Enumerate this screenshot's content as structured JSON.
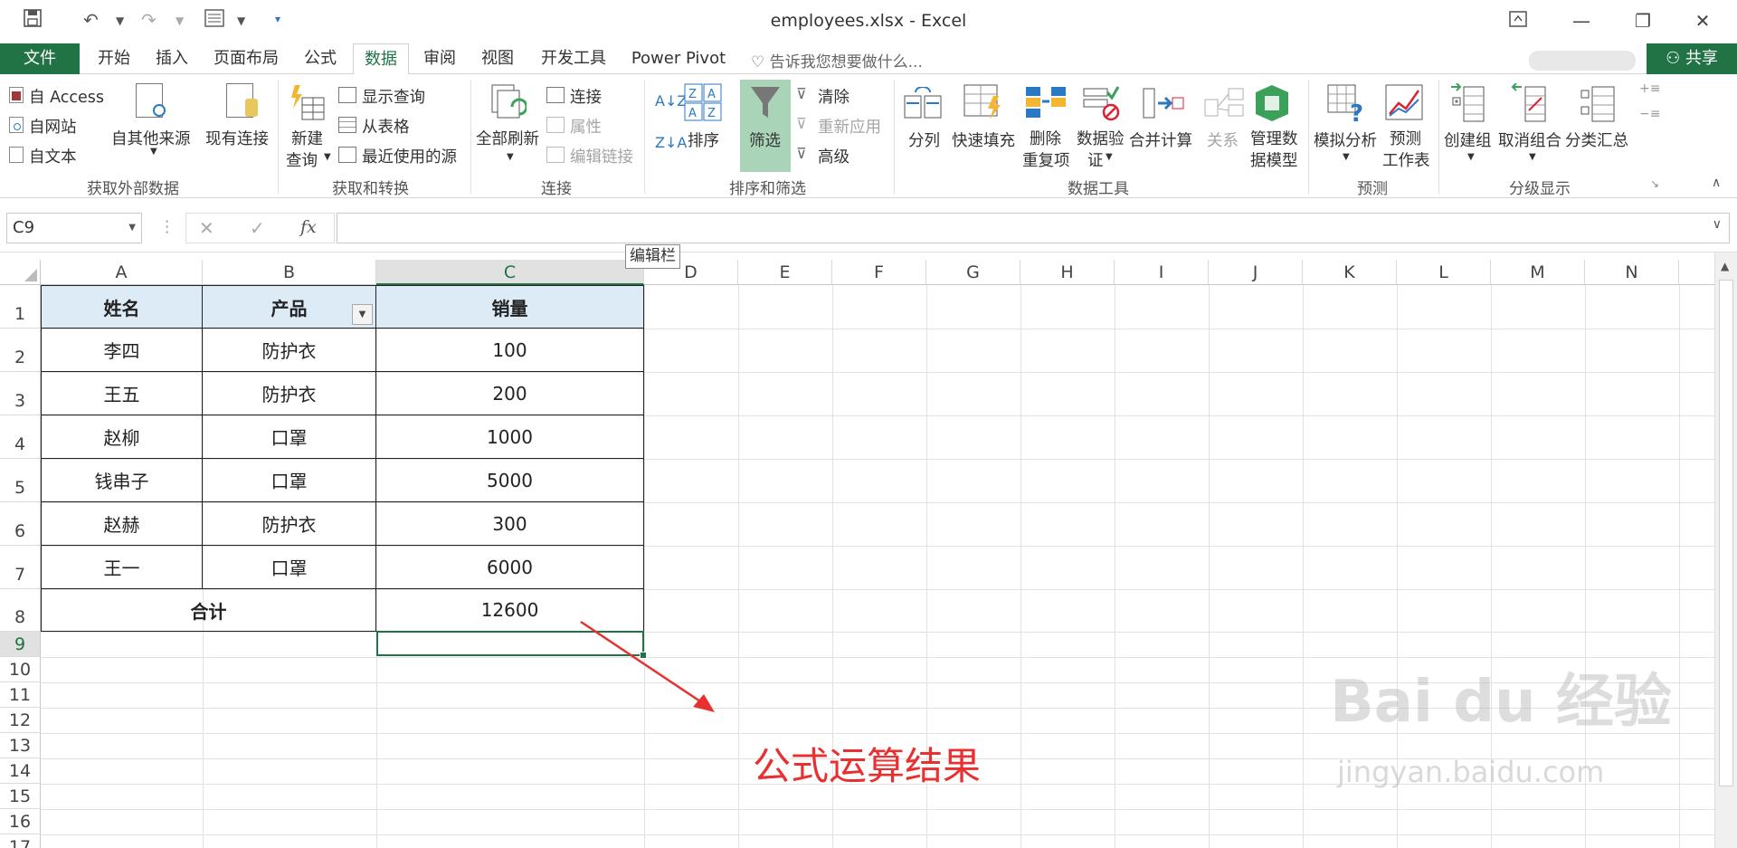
{
  "window": {
    "title": "employees.xlsx - Excel"
  },
  "tabs": {
    "file": "文件",
    "items": [
      "开始",
      "插入",
      "页面布局",
      "公式",
      "数据",
      "审阅",
      "视图",
      "开发工具",
      "Power Pivot"
    ],
    "active_index": 4,
    "tell_me": "告诉我您想要做什么...",
    "share": "共享"
  },
  "ribbon": {
    "get_external": {
      "access": "自 Access",
      "web": "自网站",
      "text": "自文本",
      "other": "自其他来源",
      "existing": "现有连接",
      "label": "获取外部数据"
    },
    "get_transform": {
      "new_query_1": "新建",
      "new_query_2": "查询",
      "show_queries": "显示查询",
      "from_table": "从表格",
      "recent_sources": "最近使用的源",
      "label": "获取和转换"
    },
    "connections": {
      "refresh_all": "全部刷新",
      "connections": "连接",
      "properties": "属性",
      "edit_links": "编辑链接",
      "label": "连接"
    },
    "sort_filter": {
      "sort": "排序",
      "filter": "筛选",
      "clear": "清除",
      "reapply": "重新应用",
      "advanced": "高级",
      "label": "排序和筛选"
    },
    "data_tools": {
      "text_to_columns": "分列",
      "flash_fill": "快速填充",
      "remove_dup_1": "删除",
      "remove_dup_2": "重复项",
      "validation_1": "数据验",
      "validation_2": "证",
      "consolidate": "合并计算",
      "relationships": "关系",
      "data_model_1": "管理数",
      "data_model_2": "据模型",
      "label": "数据工具"
    },
    "forecast": {
      "what_if": "模拟分析",
      "forecast_1": "预测",
      "forecast_2": "工作表",
      "label": "预测"
    },
    "outline": {
      "group": "创建组",
      "ungroup": "取消组合",
      "subtotal": "分类汇总",
      "label": "分级显示"
    }
  },
  "formula_bar": {
    "name_box": "C9",
    "fx": "fx",
    "value": "",
    "tooltip": "编辑栏"
  },
  "sheet": {
    "columns": [
      "A",
      "B",
      "C",
      "D",
      "E",
      "F",
      "G",
      "H",
      "I",
      "J",
      "K",
      "L",
      "M",
      "N"
    ],
    "rows": [
      "1",
      "2",
      "3",
      "4",
      "5",
      "6",
      "7",
      "8",
      "9",
      "10",
      "11",
      "12",
      "13",
      "14",
      "15",
      "16",
      "17"
    ],
    "header": [
      "姓名",
      "产品",
      "销量"
    ],
    "data": [
      [
        "李四",
        "防护衣",
        "100"
      ],
      [
        "王五",
        "防护衣",
        "200"
      ],
      [
        "赵柳",
        "口罩",
        "1000"
      ],
      [
        "钱串子",
        "口罩",
        "5000"
      ],
      [
        "赵赫",
        "防护衣",
        "300"
      ],
      [
        "王一",
        "口罩",
        "6000"
      ]
    ],
    "total_label": "合计",
    "total_value": "12600",
    "selected_cell": "C9"
  },
  "annotation": {
    "text": "公式运算结果",
    "color": "#e83030"
  },
  "watermark": {
    "line1": "Bai du 经验",
    "line2": "jingyan.baidu.com"
  },
  "colors": {
    "excel_green": "#217346",
    "header_fill": "#ddebf7"
  }
}
